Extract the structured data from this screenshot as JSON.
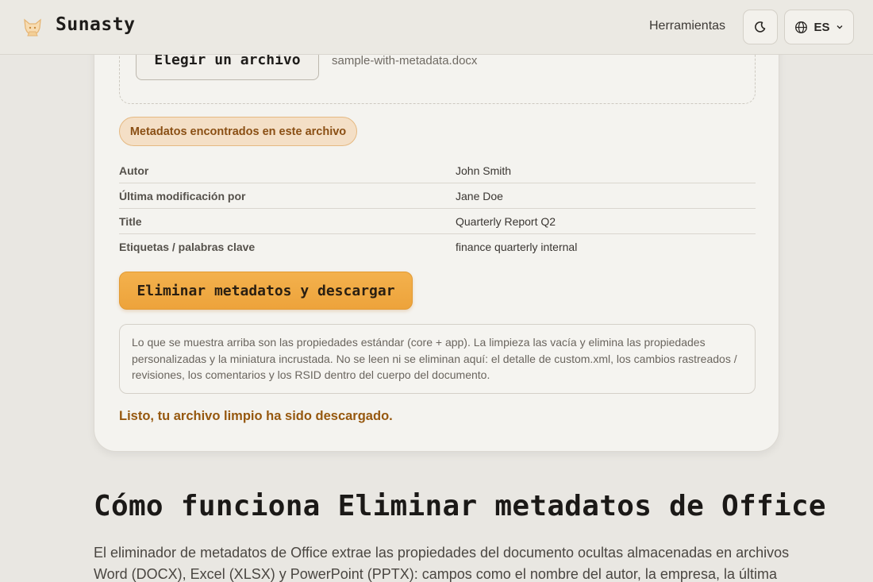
{
  "header": {
    "brand": "Sunasty",
    "nav_tools": "Herramientas",
    "language": "ES",
    "icons": {
      "logo": "fox-logo-icon",
      "theme": "moon-icon",
      "language": "globe-icon",
      "dropdown": "chevron-down-icon"
    }
  },
  "upload": {
    "choose_label": "Elegir un archivo",
    "filename": "sample-with-metadata.docx"
  },
  "metadata": {
    "badge": "Metadatos encontrados en este archivo",
    "rows": [
      {
        "key": "Autor",
        "value": "John Smith"
      },
      {
        "key": "Última modificación por",
        "value": "Jane Doe"
      },
      {
        "key": "Title",
        "value": "Quarterly Report Q2"
      },
      {
        "key": "Etiquetas / palabras clave",
        "value": "finance quarterly internal"
      }
    ]
  },
  "actions": {
    "strip_label": "Eliminar metadatos y descargar"
  },
  "note": "Lo que se muestra arriba son las propiedades estándar (core + app). La limpieza las vacía y elimina las propiedades personalizadas y la miniatura incrustada. No se leen ni se eliminan aquí: el detalle de custom.xml, los cambios rastreados / revisiones, los comentarios y los RSID dentro del cuerpo del documento.",
  "success": "Listo, tu archivo limpio ha sido descargado.",
  "section": {
    "title": "Cómo funciona Eliminar metadatos de Office",
    "body": "El eliminador de metadatos de Office extrae las propiedades del documento ocultas almacenadas en archivos Word (DOCX), Excel (XLSX) y PowerPoint (PPTX): campos como el nombre del autor, la empresa, la última"
  },
  "colors": {
    "accent": "#eda33b",
    "success": "#96580f",
    "badge_bg": "#f4dfc6"
  }
}
